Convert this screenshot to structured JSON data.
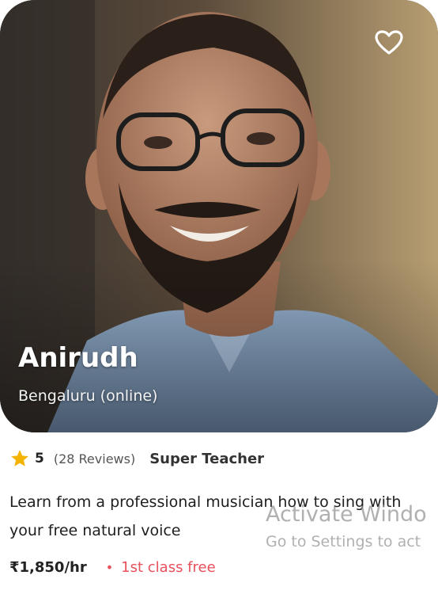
{
  "teacher": {
    "name": "Anirudh",
    "location": "Bengaluru (online)",
    "photo_icon": "teacher-portrait"
  },
  "rating": {
    "score": "5",
    "reviews": "(28 Reviews)",
    "badge": "Super Teacher",
    "star_color": "#f5b301"
  },
  "description": "Learn from a professional musician how to sing with your free natural voice",
  "pricing": {
    "price": "₹1,850/hr",
    "bullet": "•",
    "offer": "1st class free",
    "offer_color": "#e8505b"
  },
  "favorite_icon": "heart-outline-icon",
  "watermark": {
    "line1": "Activate Windo",
    "line2": "Go to Settings to act"
  }
}
